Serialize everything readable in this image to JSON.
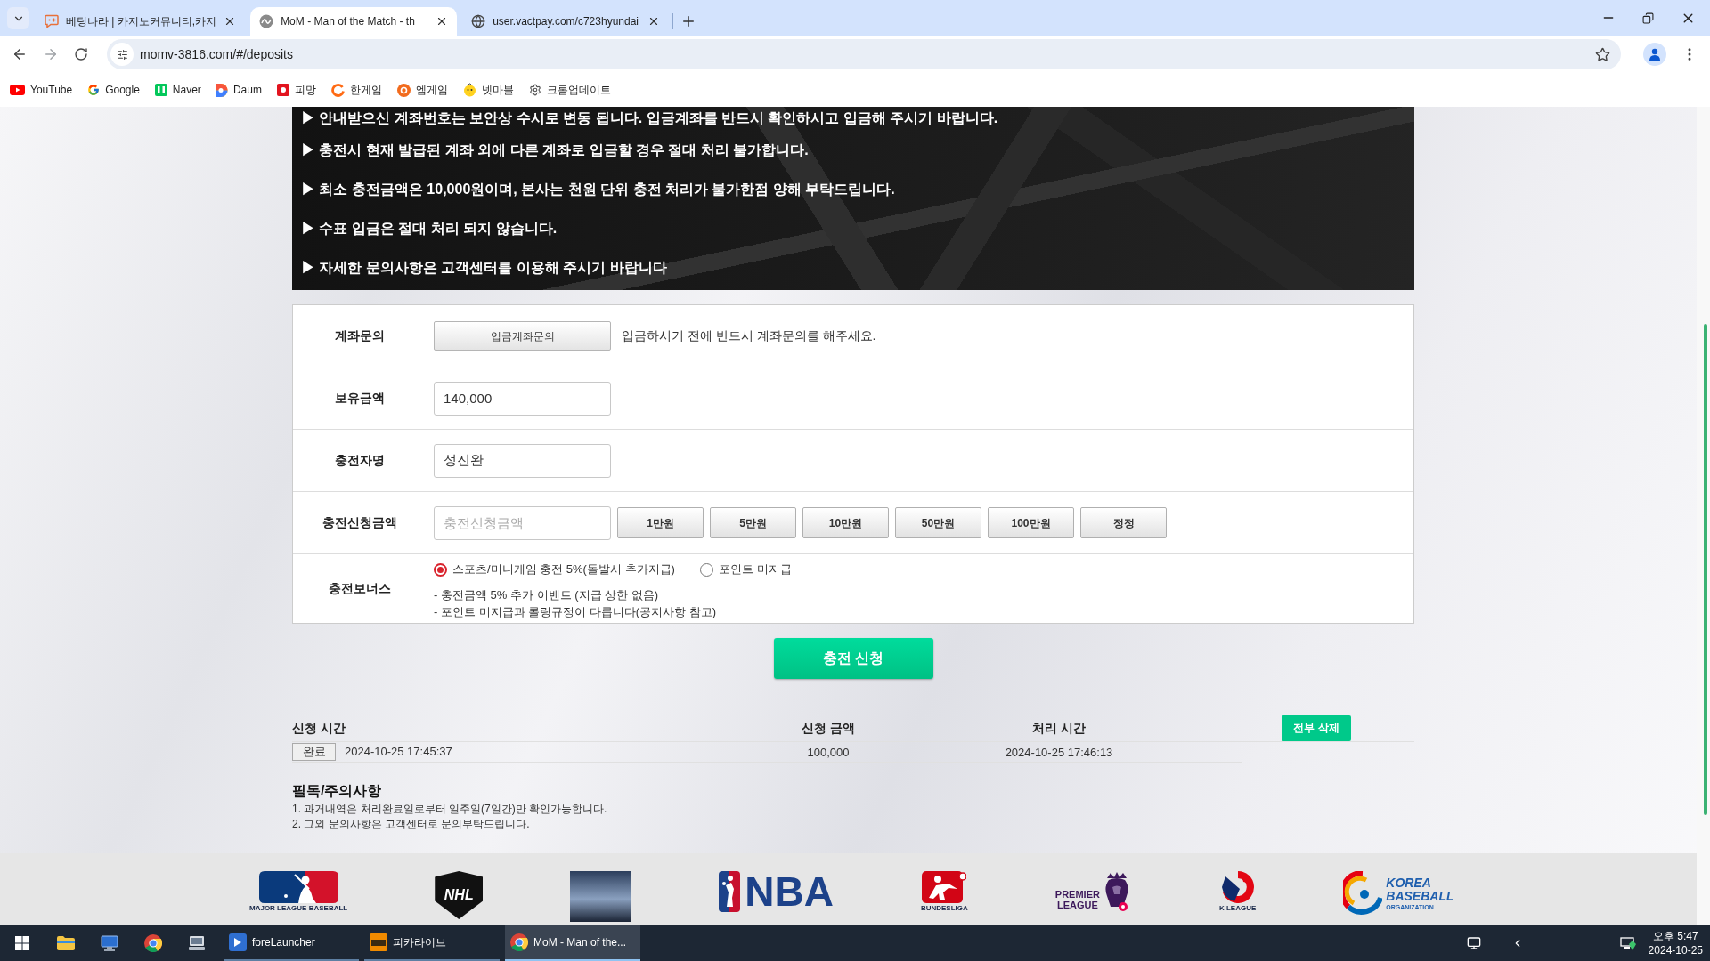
{
  "browser": {
    "tabs": [
      {
        "title": "베팅나라 | 카지노커뮤니티,카지",
        "selected": false
      },
      {
        "title": "MoM - Man of the Match - th",
        "selected": true
      },
      {
        "title": "user.vactpay.com/c723hyundai",
        "selected": false
      }
    ],
    "address": "momv-3816.com/#/deposits",
    "bookmarks": [
      "YouTube",
      "Google",
      "Naver",
      "Daum",
      "피망",
      "한게임",
      "엠게임",
      "넷마블",
      "크롬업데이트"
    ]
  },
  "notice_banner": {
    "lines": [
      "▶ 안내받으신 계좌번호는 보안상 수시로 변동 됩니다. 입금계좌를 반드시 확인하시고 입금해 주시기 바랍니다.",
      "▶ 충전시 현재 발급된 계좌 외에 다른 계좌로 입금할 경우 절대 처리 불가합니다.",
      "▶ 최소 충전금액은 10,000원이며, 본사는 천원 단위 충전 처리가 불가한점 양해 부탁드립니다.",
      "▶ 수표 입금은 절대 처리 되지 않습니다.",
      "▶ 자세한 문의사항은 고객센터를 이용해 주시기 바랍니다"
    ]
  },
  "deposit_form": {
    "rows": [
      {
        "kind": "button",
        "label": "계좌문의",
        "button": "입금계좌문의",
        "hint": "입금하시기 전에 반드시 계좌문의를 해주세요."
      },
      {
        "kind": "field",
        "label": "보유금액",
        "value": "140,000"
      },
      {
        "kind": "field",
        "label": "충전자명",
        "value": "성진완"
      },
      {
        "kind": "amount",
        "label": "충전신청금액",
        "placeholder": "충전신청금액",
        "buttons": [
          "1만원",
          "5만원",
          "10만원",
          "50만원",
          "100만원",
          "정정"
        ]
      },
      {
        "kind": "bonus",
        "label": "충전보너스",
        "options": [
          {
            "label": "스포츠/미니게임 충전 5%(돌발시 추가지급)",
            "selected": true
          },
          {
            "label": "포인트 미지급",
            "selected": false
          }
        ],
        "notes": [
          "- 충전금액 5% 추가 이벤트 (지급 상한 없음)",
          "- 포인트 미지급과 롤링규정이 다릅니다(공지사항 참고)"
        ]
      }
    ],
    "submit": "충전 신청"
  },
  "history": {
    "columns": [
      "신청 시간",
      "신청 금액",
      "처리 시간"
    ],
    "clear_button": "전부 삭제",
    "rows": [
      {
        "status": "완료",
        "requested": "2024-10-25 17:45:37",
        "amount": "100,000",
        "processed": "2024-10-25 17:46:13"
      }
    ]
  },
  "notices": {
    "title": "필독/주의사항",
    "items": [
      "1. 과거내역은 처리완료일로부터 일주일(7일간)만 확인가능합니다.",
      "2. 그외 문의사항은 고객센터로 문의부탁드립니다."
    ]
  },
  "footer_logos": [
    {
      "kind": "emblem",
      "caption": "MAJOR LEAGUE BASEBALL"
    },
    {
      "kind": "shield",
      "title": "NHL"
    },
    {
      "kind": "photo"
    },
    {
      "kind": "wordmark",
      "title": "NBA"
    },
    {
      "kind": "emblem",
      "caption": "BUNDESLIGA"
    },
    {
      "kind": "stacked",
      "lines": [
        "PREMIER",
        "LEAGUE"
      ]
    },
    {
      "kind": "emblem",
      "caption": "K LEAGUE"
    },
    {
      "kind": "stacked_right",
      "lines": [
        "KOREA",
        "BASEBALL",
        "ORGANIZATION"
      ]
    }
  ],
  "taskbar": {
    "apps": [
      {
        "label": "foreLauncher",
        "selected": false
      },
      {
        "label": "피카라이브",
        "selected": false
      },
      {
        "label": "MoM - Man of the...",
        "selected": true
      }
    ],
    "clock": {
      "time": "오후 5:47",
      "date": "2024-10-25"
    }
  }
}
